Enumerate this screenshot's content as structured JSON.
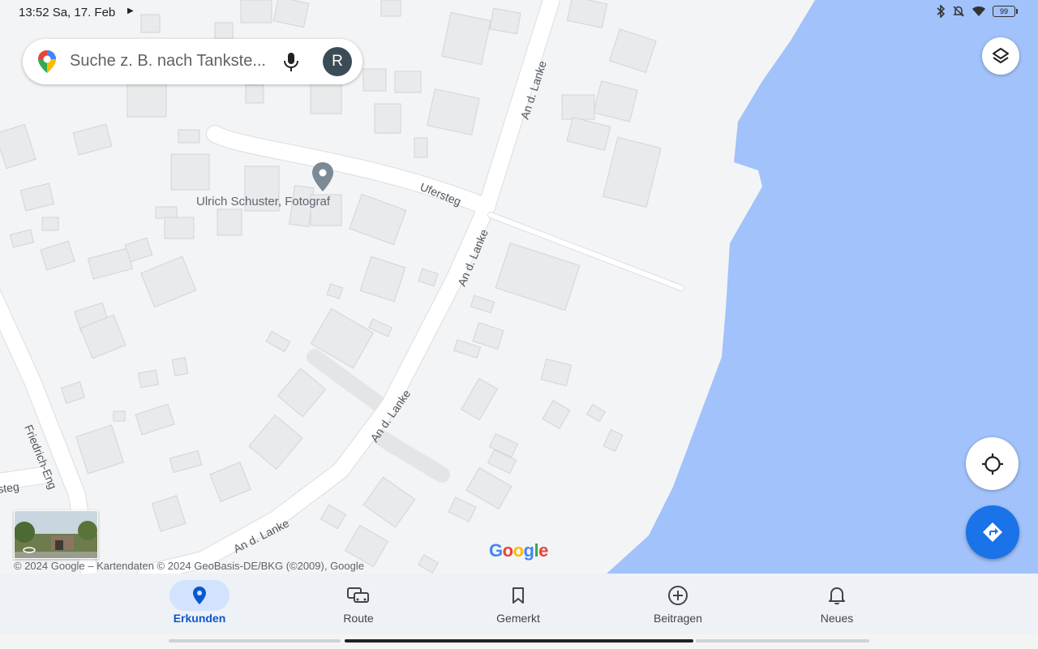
{
  "status_bar": {
    "time": "13:52 Sa, 17. Feb",
    "battery": "99"
  },
  "search": {
    "placeholder": "Suche z. B. nach Tankste...",
    "avatar_letter": "R"
  },
  "map": {
    "poi_label": "Ulrich Schuster, Fotograf",
    "street_labels": [
      "An d. Lanke",
      "An d. Lanke",
      "An d. Lanke",
      "An d. Lanke",
      "Ufersteg",
      "Friedrich-Eng",
      "steg"
    ],
    "copyright": "© 2024 Google – Kartendaten © 2024 GeoBasis-DE/BKG (©2009), Google",
    "logo": "Google",
    "water_color": "#a1c2fa"
  },
  "nav": {
    "items": [
      {
        "label": "Erkunden",
        "icon": "explore-pin-icon",
        "active": true
      },
      {
        "label": "Route",
        "icon": "car-icon",
        "active": false
      },
      {
        "label": "Gemerkt",
        "icon": "bookmark-icon",
        "active": false
      },
      {
        "label": "Beitragen",
        "icon": "plus-circle-icon",
        "active": false
      },
      {
        "label": "Neues",
        "icon": "bell-icon",
        "active": false
      }
    ]
  },
  "colors": {
    "accent": "#1a73e8",
    "active_nav_bg": "#d3e3fd"
  }
}
